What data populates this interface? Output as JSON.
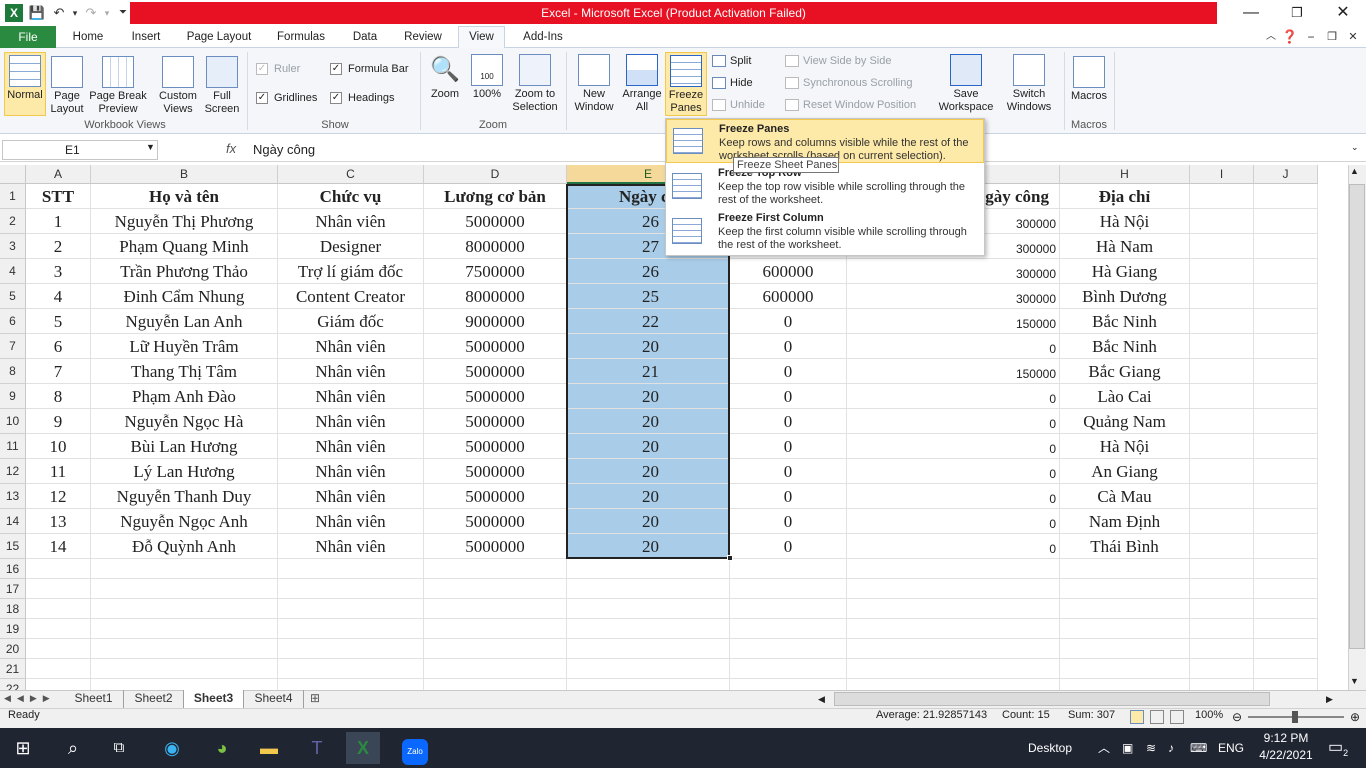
{
  "titlebar": {
    "title": "Excel - Microsoft Excel (Product Activation Failed)"
  },
  "tabs": [
    "File",
    "Home",
    "Insert",
    "Page Layout",
    "Formulas",
    "Data",
    "Review",
    "View",
    "Add-Ins"
  ],
  "ribbon": {
    "workbook_views": {
      "normal": "Normal",
      "page_layout": "Page Layout",
      "page_break": "Page Break Preview",
      "custom": "Custom Views",
      "full": "Full Screen",
      "label": "Workbook Views"
    },
    "show": {
      "ruler": "Ruler",
      "formula_bar": "Formula Bar",
      "gridlines": "Gridlines",
      "headings": "Headings",
      "label": "Show"
    },
    "zoom": {
      "zoom": "Zoom",
      "hundred": "100%",
      "zoom_sel": "Zoom to Selection",
      "label": "Zoom"
    },
    "window": {
      "new": "New Window",
      "arrange": "Arrange All",
      "freeze": "Freeze Panes",
      "split": "Split",
      "hide": "Hide",
      "unhide": "Unhide",
      "side": "View Side by Side",
      "sync": "Synchronous Scrolling",
      "reset": "Reset Window Position",
      "save_ws": "Save Workspace",
      "switch": "Switch Windows"
    },
    "macros": {
      "macros": "Macros",
      "label": "Macros"
    }
  },
  "formula": {
    "namebox": "E1",
    "fx": "fx",
    "value": "Ngày công"
  },
  "columns": [
    "A",
    "B",
    "C",
    "D",
    "E",
    "F",
    "G",
    "H",
    "I",
    "J"
  ],
  "headers": {
    "stt": "STT",
    "name": "Họ và tên",
    "role": "Chức vụ",
    "salary": "Lương cơ bản",
    "days": "Ngày cô",
    "bonus_partial": "gày công",
    "address": "Địa chỉ"
  },
  "rows": [
    {
      "n": "2",
      "stt": "1",
      "name": "Nguyễn Thị Phương",
      "role": "Nhân viên",
      "salary": "5000000",
      "days": "26",
      "f": "",
      "g": "300000",
      "addr": "Hà Nội"
    },
    {
      "n": "3",
      "stt": "2",
      "name": "Phạm Quang Minh",
      "role": "Designer",
      "salary": "8000000",
      "days": "27",
      "f": "",
      "g": "300000",
      "addr": "Hà Nam"
    },
    {
      "n": "4",
      "stt": "3",
      "name": "Trần Phương Thảo",
      "role": "Trợ lí giám đốc",
      "salary": "7500000",
      "days": "26",
      "f": "600000",
      "g": "300000",
      "addr": "Hà Giang"
    },
    {
      "n": "5",
      "stt": "4",
      "name": "Đinh Cẩm Nhung",
      "role": "Content Creator",
      "salary": "8000000",
      "days": "25",
      "f": "600000",
      "g": "300000",
      "addr": "Bình Dương"
    },
    {
      "n": "6",
      "stt": "5",
      "name": "Nguyễn Lan Anh",
      "role": "Giám đốc",
      "salary": "9000000",
      "days": "22",
      "f": "0",
      "g": "150000",
      "addr": "Bắc Ninh"
    },
    {
      "n": "7",
      "stt": "6",
      "name": "Lữ Huyền Trâm",
      "role": "Nhân viên",
      "salary": "5000000",
      "days": "20",
      "f": "0",
      "g": "0",
      "addr": "Bắc Ninh"
    },
    {
      "n": "8",
      "stt": "7",
      "name": "Thang Thị Tâm",
      "role": "Nhân viên",
      "salary": "5000000",
      "days": "21",
      "f": "0",
      "g": "150000",
      "addr": "Bắc Giang"
    },
    {
      "n": "9",
      "stt": "8",
      "name": "Phạm Anh Đào",
      "role": "Nhân viên",
      "salary": "5000000",
      "days": "20",
      "f": "0",
      "g": "0",
      "addr": "Lào Cai"
    },
    {
      "n": "10",
      "stt": "9",
      "name": "Nguyễn Ngọc Hà",
      "role": "Nhân viên",
      "salary": "5000000",
      "days": "20",
      "f": "0",
      "g": "0",
      "addr": "Quảng Nam"
    },
    {
      "n": "11",
      "stt": "10",
      "name": "Bùi Lan Hương",
      "role": "Nhân viên",
      "salary": "5000000",
      "days": "20",
      "f": "0",
      "g": "0",
      "addr": "Hà Nội"
    },
    {
      "n": "12",
      "stt": "11",
      "name": "Lý Lan Hương",
      "role": "Nhân viên",
      "salary": "5000000",
      "days": "20",
      "f": "0",
      "g": "0",
      "addr": "An Giang"
    },
    {
      "n": "13",
      "stt": "12",
      "name": "Nguyễn Thanh Duy",
      "role": "Nhân viên",
      "salary": "5000000",
      "days": "20",
      "f": "0",
      "g": "0",
      "addr": "Cà Mau"
    },
    {
      "n": "14",
      "stt": "13",
      "name": "Nguyễn Ngọc Anh",
      "role": "Nhân viên",
      "salary": "5000000",
      "days": "20",
      "f": "0",
      "g": "0",
      "addr": "Nam Định"
    },
    {
      "n": "15",
      "stt": "14",
      "name": "Đỗ Quỳnh Anh",
      "role": "Nhân viên",
      "salary": "5000000",
      "days": "20",
      "f": "0",
      "g": "0",
      "addr": "Thái Bình"
    }
  ],
  "blank_rows": [
    "16",
    "17",
    "18",
    "19",
    "20",
    "21",
    "22"
  ],
  "dropdown": {
    "items": [
      {
        "title": "Freeze Panes",
        "desc": "Keep rows and columns visible while the rest of the worksheet scrolls (based on current selection)."
      },
      {
        "title": "Freeze Top Row",
        "desc": "Keep the top row visible while scrolling through the rest of the worksheet."
      },
      {
        "title": "Freeze First Column",
        "desc": "Keep the first column visible while scrolling through the rest of the worksheet."
      }
    ],
    "tooltip": "Freeze Sheet Panes"
  },
  "sheets": [
    "Sheet1",
    "Sheet2",
    "Sheet3",
    "Sheet4"
  ],
  "status": {
    "ready": "Ready",
    "average": "Average: 21.92857143",
    "count": "Count: 15",
    "sum": "Sum: 307",
    "zoom": "100%"
  },
  "taskbar": {
    "desktop": "Desktop",
    "lang": "ENG",
    "time": "9:12 PM",
    "date": "4/22/2021",
    "notif": "2",
    "zalo": "Zalo"
  },
  "colors": {
    "title_red": "#e81123",
    "file_green": "#2a8a3f",
    "selection": "#a9cde8",
    "highlight": "#fde9a8"
  }
}
